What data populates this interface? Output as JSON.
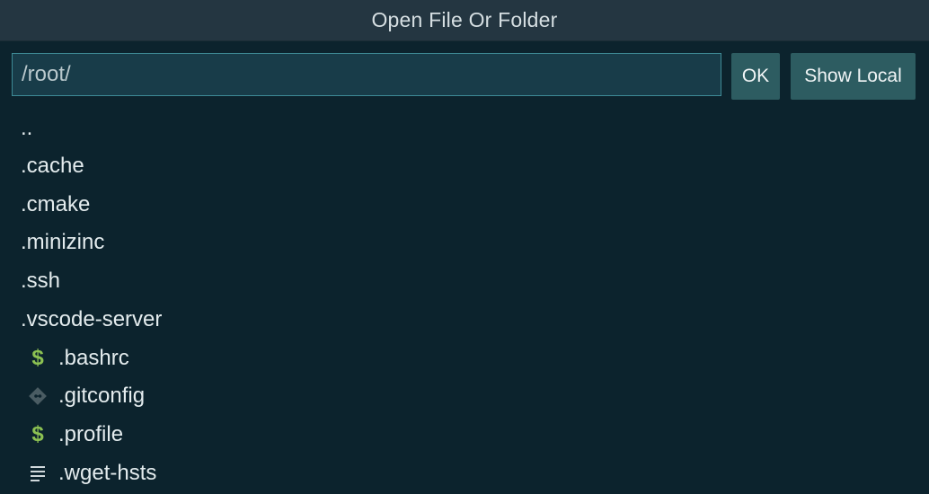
{
  "dialog": {
    "title": "Open File Or Folder"
  },
  "path": {
    "value": "/root/"
  },
  "buttons": {
    "ok": "OK",
    "show_local": "Show Local"
  },
  "entries": [
    {
      "name": "..",
      "kind": "directory"
    },
    {
      "name": ".cache",
      "kind": "directory"
    },
    {
      "name": ".cmake",
      "kind": "directory"
    },
    {
      "name": ".minizinc",
      "kind": "directory"
    },
    {
      "name": ".ssh",
      "kind": "directory"
    },
    {
      "name": ".vscode-server",
      "kind": "directory"
    },
    {
      "name": ".bashrc",
      "kind": "file",
      "icon": "shell-dollar-icon"
    },
    {
      "name": ".gitconfig",
      "kind": "file",
      "icon": "git-icon"
    },
    {
      "name": ".profile",
      "kind": "file",
      "icon": "shell-dollar-icon"
    },
    {
      "name": ".wget-hsts",
      "kind": "file",
      "icon": "text-file-icon"
    }
  ],
  "colors": {
    "background": "#0c232d",
    "titlebar": "#243641",
    "input_bg": "#183c49",
    "input_border": "#3e8b96",
    "button_bg": "#2d5c61",
    "shell_icon": "#8cc152",
    "git_icon": "#4a5c63"
  }
}
